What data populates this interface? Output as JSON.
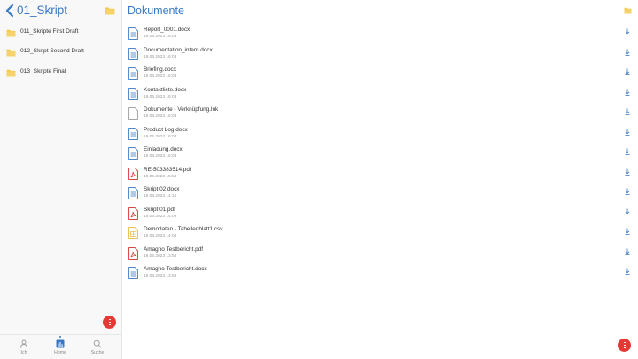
{
  "sidebar": {
    "title": "01_Skript",
    "folders": [
      {
        "label": "011_Skripte First Draft"
      },
      {
        "label": "012_Skript Second Draft"
      },
      {
        "label": "013_Skripte Final"
      }
    ]
  },
  "bottom_nav": {
    "items": [
      {
        "label": "Ich",
        "icon": "person-icon"
      },
      {
        "label": "Home",
        "icon": "home-icon",
        "active": true
      },
      {
        "label": "Suche",
        "icon": "search-icon"
      }
    ]
  },
  "main": {
    "title": "Dokumente",
    "files": [
      {
        "name": "Report_0001.docx",
        "date": "19.06.2023 16:03",
        "type": "docx"
      },
      {
        "name": "Documentation_intern.docx",
        "date": "19.06.2023 16:03",
        "type": "docx"
      },
      {
        "name": "Briefing.docx",
        "date": "19.06.2023 16:03",
        "type": "docx"
      },
      {
        "name": "Kontaktliste.docx",
        "date": "19.06.2023 16:03",
        "type": "docx"
      },
      {
        "name": "Dokumente - Verknüpfung.lnk",
        "date": "19.06.2023 16:03",
        "type": "lnk"
      },
      {
        "name": "Product Log.docx",
        "date": "19.06.2023 16:03",
        "type": "docx"
      },
      {
        "name": "Einladung.docx",
        "date": "19.06.2023 16:03",
        "type": "docx"
      },
      {
        "name": "RE-503383514.pdf",
        "date": "19.06.2023 15:54",
        "type": "pdf"
      },
      {
        "name": "Skript 02.docx",
        "date": "19.06.2023 14:10",
        "type": "docx"
      },
      {
        "name": "Skript 01.pdf",
        "date": "19.06.2023 14:09",
        "type": "pdf"
      },
      {
        "name": "Demodaten - Tabellenblatt1.csv",
        "date": "19.06.2023 14:08",
        "type": "csv"
      },
      {
        "name": "Amagno Testbericht.pdf",
        "date": "19.06.2023 13:58",
        "type": "pdf"
      },
      {
        "name": "Amagno Testbericht.docx",
        "date": "19.06.2023 13:58",
        "type": "docx"
      }
    ]
  },
  "colors": {
    "accent": "#3a78c3",
    "folder": "#f2c94c",
    "pdf": "#d32f2f",
    "csv": "#f2c94c",
    "fab": "#e53935"
  }
}
